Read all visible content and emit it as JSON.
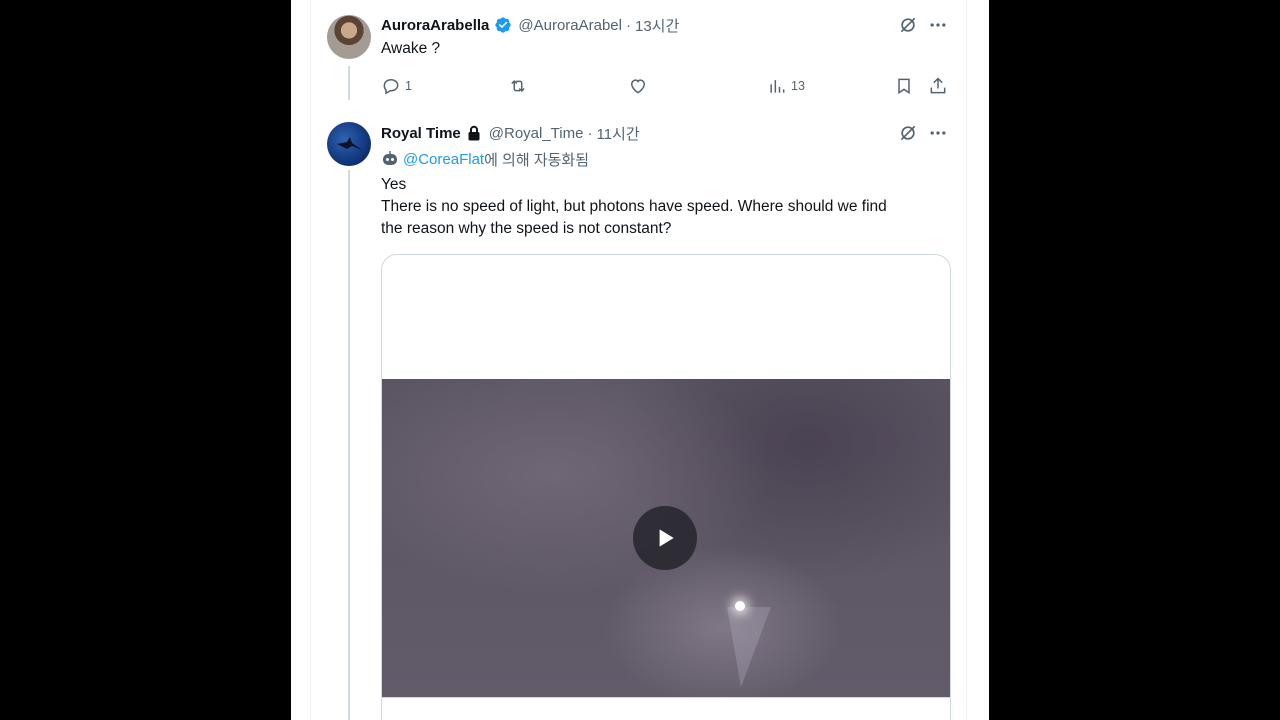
{
  "tweet1": {
    "name": "AuroraArabella",
    "handle": "@AuroraArabel",
    "dot": "·",
    "time": "13시간",
    "text": "Awake ?",
    "reply_count": "1",
    "repost_count": "",
    "like_count": "",
    "view_count": "13"
  },
  "tweet2": {
    "name": "Royal Time",
    "handle": "@Royal_Time",
    "dot": "·",
    "time": "11시간",
    "auto_mention": "@CoreaFlat",
    "auto_suffix": "에 의해 자동화됨",
    "line1": "Yes",
    "line2": "There is no speed of light, but photons have speed. Where should we find",
    "line3": "the reason why the speed is not constant?"
  },
  "colors": {
    "accent": "#1d9bf0",
    "secondary_text": "#536471",
    "primary_text": "#0f1419"
  }
}
